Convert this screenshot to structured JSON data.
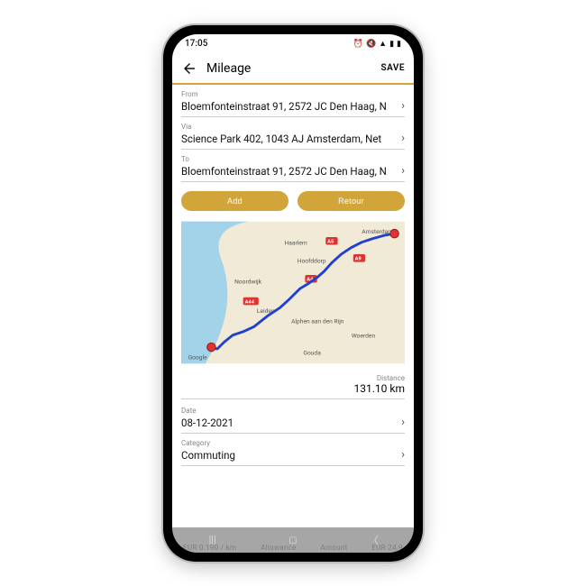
{
  "status": {
    "time": "17:05"
  },
  "header": {
    "title": "Mileage",
    "save": "SAVE"
  },
  "fields": {
    "from": {
      "label": "From",
      "value": "Bloemfonteinstraat 91, 2572 JC Den Haag, N"
    },
    "via": {
      "label": "Via",
      "value": "Science Park 402, 1043 AJ Amsterdam, Net"
    },
    "to": {
      "label": "To",
      "value": "Bloemfonteinstraat 91, 2572 JC Den Haag, N"
    }
  },
  "buttons": {
    "add": "Add",
    "retour": "Retour"
  },
  "map": {
    "cities": [
      "Amsterdam",
      "Haarlem",
      "Hoofddorp",
      "Noordwijk",
      "Leiden",
      "Alphen aan den Rijn",
      "Woerden",
      "Gouda"
    ],
    "roads": [
      "A5",
      "A9",
      "A4",
      "A44"
    ],
    "attribution": "Google"
  },
  "distance": {
    "label": "Distance",
    "value": "131.10 km"
  },
  "date": {
    "label": "Date",
    "value": "08-12-2021"
  },
  "category": {
    "label": "Category",
    "value": "Commuting"
  },
  "faded": {
    "left": "EUR 0.190 / km",
    "center": "Allowance",
    "right": "Amount",
    "far_right": "EUR 24.9"
  }
}
